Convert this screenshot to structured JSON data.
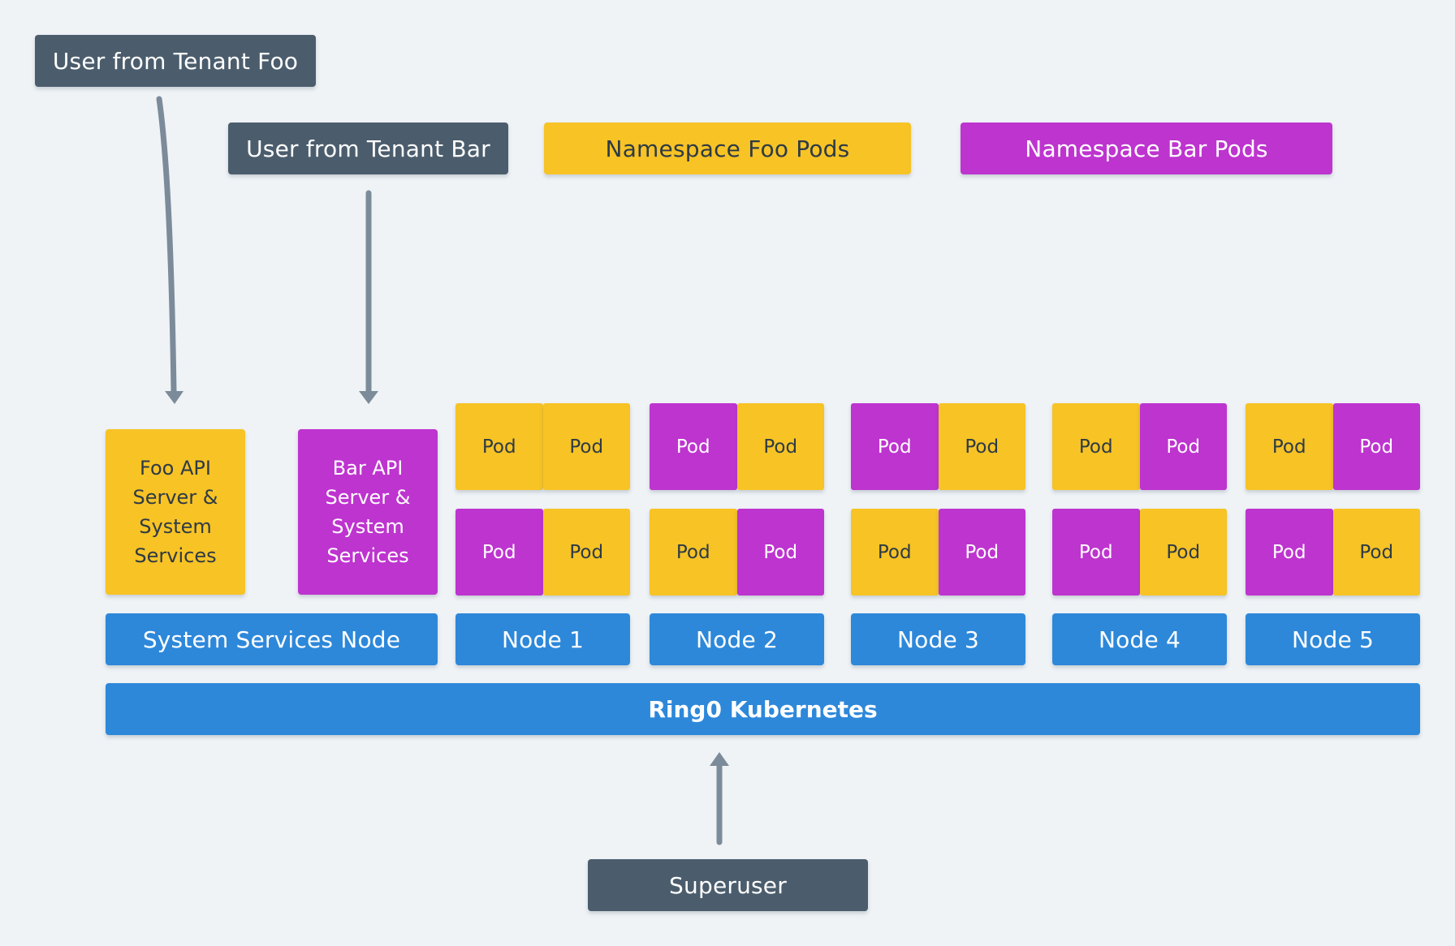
{
  "users": {
    "tenant_foo": "User from Tenant Foo",
    "tenant_bar": "User from Tenant Bar",
    "superuser": "Superuser"
  },
  "legend": {
    "foo": "Namespace Foo Pods",
    "bar": "Namespace Bar Pods"
  },
  "system": {
    "foo_api": [
      "Foo API",
      "Server &",
      "System",
      "Services"
    ],
    "bar_api": [
      "Bar API",
      "Server &",
      "System",
      "Services"
    ],
    "node_label": "System Services Node"
  },
  "nodes": [
    {
      "label": "Node 1",
      "pods": [
        [
          "foo",
          "foo"
        ],
        [
          "bar",
          "foo"
        ]
      ]
    },
    {
      "label": "Node 2",
      "pods": [
        [
          "bar",
          "foo"
        ],
        [
          "foo",
          "bar"
        ]
      ]
    },
    {
      "label": "Node 3",
      "pods": [
        [
          "bar",
          "foo"
        ],
        [
          "foo",
          "bar"
        ]
      ]
    },
    {
      "label": "Node 4",
      "pods": [
        [
          "foo",
          "bar"
        ],
        [
          "bar",
          "foo"
        ]
      ]
    },
    {
      "label": "Node 5",
      "pods": [
        [
          "foo",
          "bar"
        ],
        [
          "bar",
          "foo"
        ]
      ]
    }
  ],
  "pod_label": "Pod",
  "cluster": {
    "label": "Ring0 Kubernetes"
  },
  "colors": {
    "foo": "#F7C325",
    "bar": "#BE34CF",
    "node": "#2D88DA",
    "user": "#4B5D6D",
    "arrow": "#7C8B99",
    "background": "#EFF3F6"
  }
}
